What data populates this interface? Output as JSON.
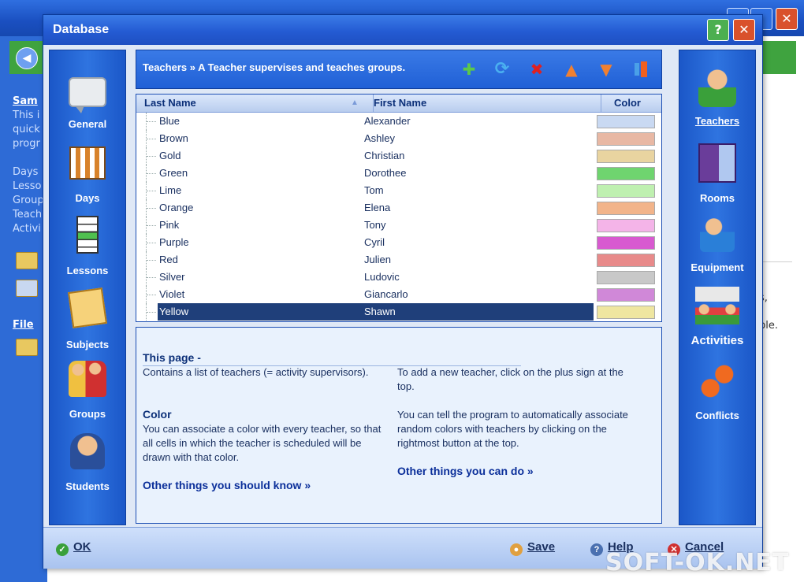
{
  "background_app": {
    "sidebar_heading": "Sam",
    "sidebar_lines": [
      "This i",
      "quick",
      "progr"
    ],
    "sidebar_list": [
      "Days",
      "Lesso",
      "Group",
      "Teach",
      "Activi"
    ],
    "file_label": "File",
    "right_lines": [
      "t",
      "s,",
      "ble."
    ]
  },
  "dialog": {
    "title": "Database",
    "help_icon": "question-icon",
    "close_icon": "close-icon"
  },
  "left_nav": [
    {
      "label": "General",
      "icon": "speech-bubble-icon"
    },
    {
      "label": "Days",
      "icon": "calendar-days-icon"
    },
    {
      "label": "Lessons",
      "icon": "lessons-bars-icon"
    },
    {
      "label": "Subjects",
      "icon": "notebook-icon"
    },
    {
      "label": "Groups",
      "icon": "group-people-icon"
    },
    {
      "label": "Students",
      "icon": "student-icon"
    }
  ],
  "right_nav": [
    {
      "label": "Teachers",
      "icon": "teacher-icon",
      "active": true
    },
    {
      "label": "Rooms",
      "icon": "room-door-icon"
    },
    {
      "label": "Equipment",
      "icon": "equipment-person-icon"
    },
    {
      "label": "Activities",
      "icon": "activities-icon"
    },
    {
      "label": "Conflicts",
      "icon": "conflicts-icon"
    }
  ],
  "toolbar": {
    "title": "Teachers » A Teacher supervises and teaches groups.",
    "buttons": [
      "add-icon",
      "random-colors-icon",
      "delete-icon",
      "move-up-icon",
      "move-down-icon",
      "auto-color-icon"
    ]
  },
  "table": {
    "columns": [
      "Last Name",
      "First Name",
      "Color"
    ],
    "rows": [
      {
        "last": "Blue",
        "first": "Alexander",
        "color": "#c9d9f2"
      },
      {
        "last": "Brown",
        "first": "Ashley",
        "color": "#e8b8a4"
      },
      {
        "last": "Gold",
        "first": "Christian",
        "color": "#e9d4a0"
      },
      {
        "last": "Green",
        "first": "Dorothee",
        "color": "#6fd46f"
      },
      {
        "last": "Lime",
        "first": "Tom",
        "color": "#bff0b0"
      },
      {
        "last": "Orange",
        "first": "Elena",
        "color": "#f2b48a"
      },
      {
        "last": "Pink",
        "first": "Tony",
        "color": "#f4b4e8"
      },
      {
        "last": "Purple",
        "first": "Cyril",
        "color": "#d85ad0"
      },
      {
        "last": "Red",
        "first": "Julien",
        "color": "#e88a8a"
      },
      {
        "last": "Silver",
        "first": "Ludovic",
        "color": "#c8c8c8"
      },
      {
        "last": "Violet",
        "first": "Giancarlo",
        "color": "#d088d8"
      },
      {
        "last": "Yellow",
        "first": "Shawn",
        "color": "#efe6a0",
        "selected": true
      }
    ]
  },
  "info": {
    "page_title": "This page -",
    "p1": "Contains a list of teachers (= activity supervisors).",
    "p2": "To add a new teacher, click on the plus sign at the top.",
    "color_heading": "Color",
    "p3": "You can associate a color with every teacher, so that all cells in which the teacher is scheduled will be drawn with that color.",
    "p4": "You can tell the program to automatically associate random colors with teachers by clicking on the rightmost button at the top.",
    "link1": "Other things you should know »",
    "link2": "Other things you can do »"
  },
  "footer": {
    "ok": "OK",
    "save": "Save",
    "help": "Help",
    "cancel": "Cancel"
  },
  "watermark": "SOFT-OK.NET"
}
